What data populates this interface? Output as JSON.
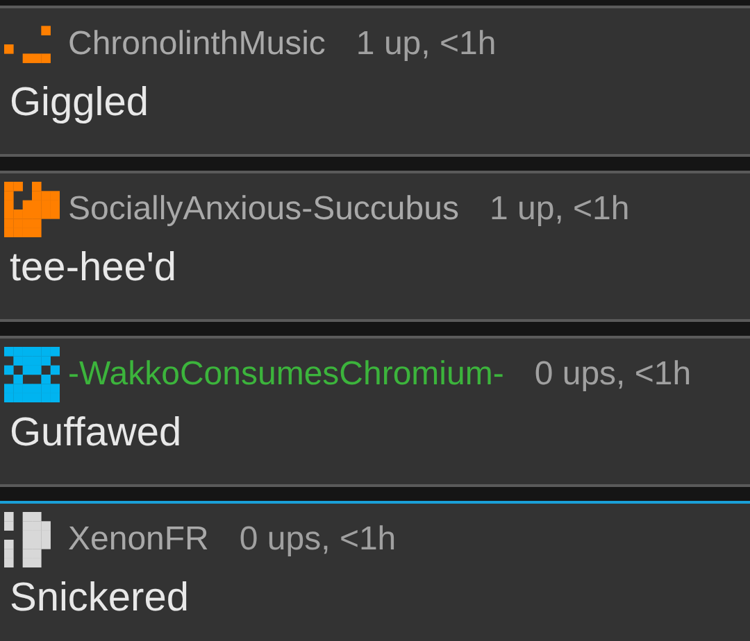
{
  "comments": [
    {
      "avatar": {
        "color": "#ff7f00"
      },
      "username": {
        "text": "ChronolinthMusic",
        "color": "#a9a9a9"
      },
      "meta": "1 up, <1h",
      "body": "Giggled",
      "highlighted": false
    },
    {
      "avatar": {
        "color": "#ff7f00"
      },
      "username": {
        "text": "SociallyAnxious-Succubus",
        "color": "#a9a9a9"
      },
      "meta": "1 up, <1h",
      "body": "tee-hee'd",
      "highlighted": false
    },
    {
      "avatar": {
        "color": "#00b4f0"
      },
      "username": {
        "text": "-WakkoConsumesChromium-",
        "color": "#3cb43c"
      },
      "meta": "0 ups, <1h",
      "body": "Guffawed",
      "highlighted": false
    },
    {
      "avatar": {
        "color": "#d8d8d8"
      },
      "username": {
        "text": "XenonFR",
        "color": "#a9a9a9"
      },
      "meta": "0 ups, <1h",
      "body": "Snickered",
      "highlighted": true
    }
  ]
}
